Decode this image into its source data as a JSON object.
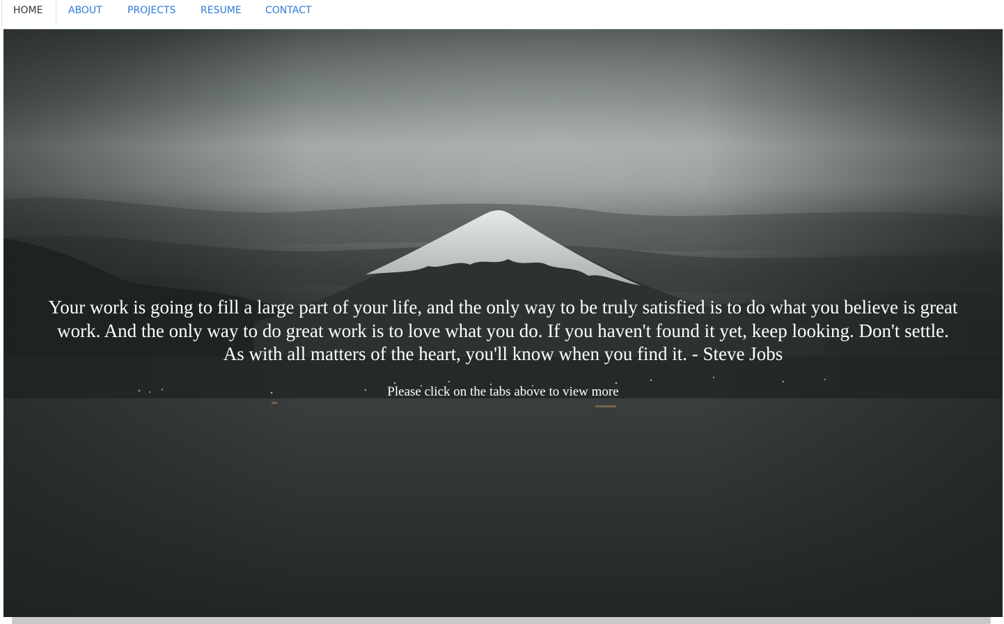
{
  "nav": {
    "tabs": [
      {
        "label": "HOME",
        "active": true
      },
      {
        "label": "ABOUT",
        "active": false
      },
      {
        "label": "PROJECTS",
        "active": false
      },
      {
        "label": "RESUME",
        "active": false
      },
      {
        "label": "CONTACT",
        "active": false
      }
    ]
  },
  "hero": {
    "quote": "Your work is going to fill a large part of your life, and the only way to be truly satisfied is to do what you believe is great work. And the only way to do great work is to love what you do. If you haven't found it yet, keep looking. Don't settle. As with all matters of the heart, you'll know when you find it. - Steve Jobs",
    "hint": "Please click on the tabs above to view more"
  },
  "colors": {
    "link": "#2f7ad8",
    "active_tab_text": "#333333",
    "hero_text": "#ffffff"
  }
}
